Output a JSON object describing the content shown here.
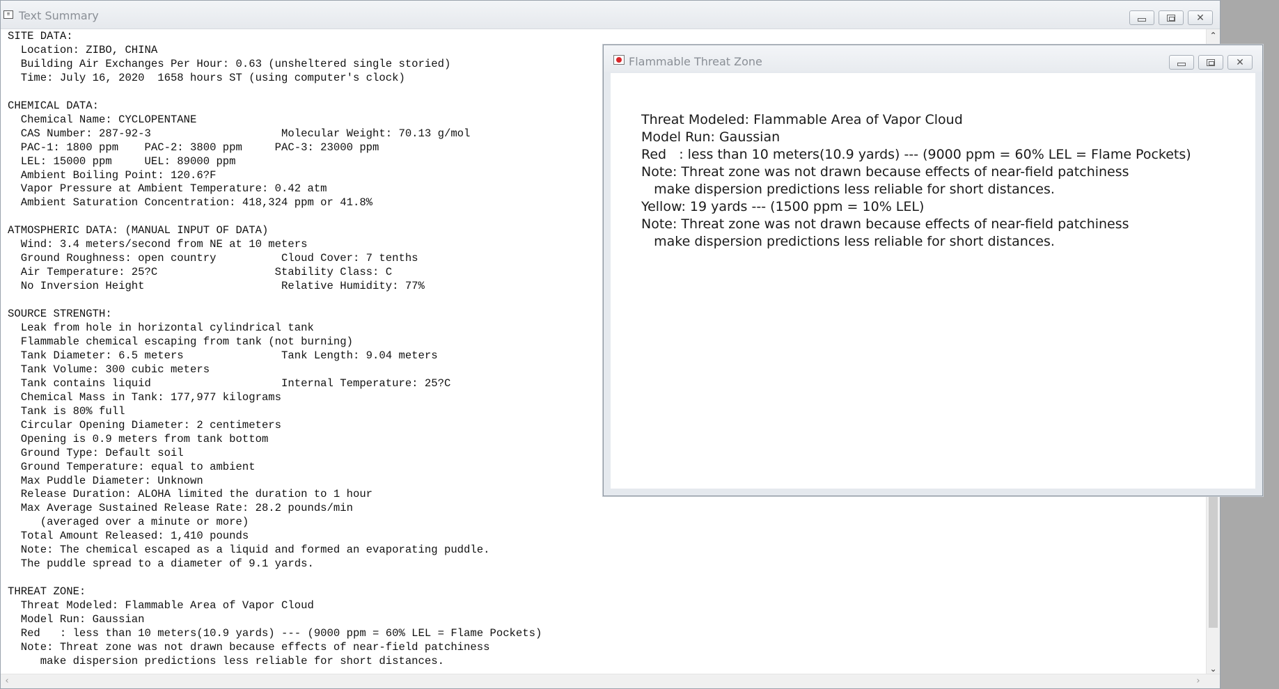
{
  "summary_window": {
    "title": "Text Summary",
    "content": "SITE DATA:\n  Location: ZIBO, CHINA\n  Building Air Exchanges Per Hour: 0.63 (unsheltered single storied)\n  Time: July 16, 2020  1658 hours ST (using computer's clock)\n\nCHEMICAL DATA:\n  Chemical Name: CYCLOPENTANE\n  CAS Number: 287-92-3                    Molecular Weight: 70.13 g/mol\n  PAC-1: 1800 ppm    PAC-2: 3800 ppm     PAC-3: 23000 ppm\n  LEL: 15000 ppm     UEL: 89000 ppm\n  Ambient Boiling Point: 120.6?F\n  Vapor Pressure at Ambient Temperature: 0.42 atm\n  Ambient Saturation Concentration: 418,324 ppm or 41.8%\n\nATMOSPHERIC DATA: (MANUAL INPUT OF DATA)\n  Wind: 3.4 meters/second from NE at 10 meters\n  Ground Roughness: open country          Cloud Cover: 7 tenths\n  Air Temperature: 25?C                  Stability Class: C\n  No Inversion Height                     Relative Humidity: 77%\n\nSOURCE STRENGTH:\n  Leak from hole in horizontal cylindrical tank\n  Flammable chemical escaping from tank (not burning)\n  Tank Diameter: 6.5 meters               Tank Length: 9.04 meters\n  Tank Volume: 300 cubic meters\n  Tank contains liquid                    Internal Temperature: 25?C\n  Chemical Mass in Tank: 177,977 kilograms\n  Tank is 80% full\n  Circular Opening Diameter: 2 centimeters\n  Opening is 0.9 meters from tank bottom\n  Ground Type: Default soil\n  Ground Temperature: equal to ambient\n  Max Puddle Diameter: Unknown\n  Release Duration: ALOHA limited the duration to 1 hour\n  Max Average Sustained Release Rate: 28.2 pounds/min\n     (averaged over a minute or more)\n  Total Amount Released: 1,410 pounds\n  Note: The chemical escaped as a liquid and formed an evaporating puddle.\n  The puddle spread to a diameter of 9.1 yards.\n\nTHREAT ZONE:\n  Threat Modeled: Flammable Area of Vapor Cloud\n  Model Run: Gaussian\n  Red   : less than 10 meters(10.9 yards) --- (9000 ppm = 60% LEL = Flame Pockets)\n  Note: Threat zone was not drawn because effects of near-field patchiness\n     make dispersion predictions less reliable for short distances."
  },
  "threat_window": {
    "title": "Flammable Threat Zone",
    "content": "Threat Modeled: Flammable Area of Vapor Cloud\nModel Run: Gaussian\nRed   : less than 10 meters(10.9 yards) --- (9000 ppm = 60% LEL = Flame Pockets)\nNote: Threat zone was not drawn because effects of near-field patchiness\n   make dispersion predictions less reliable for short distances.\nYellow: 19 yards --- (1500 ppm = 10% LEL)\nNote: Threat zone was not drawn because effects of near-field patchiness\n   make dispersion predictions less reliable for short distances."
  },
  "caption_buttons": {
    "minimize_icon": "minimize-icon",
    "restore_icon": "restore-icon",
    "close_icon": "close-icon"
  }
}
